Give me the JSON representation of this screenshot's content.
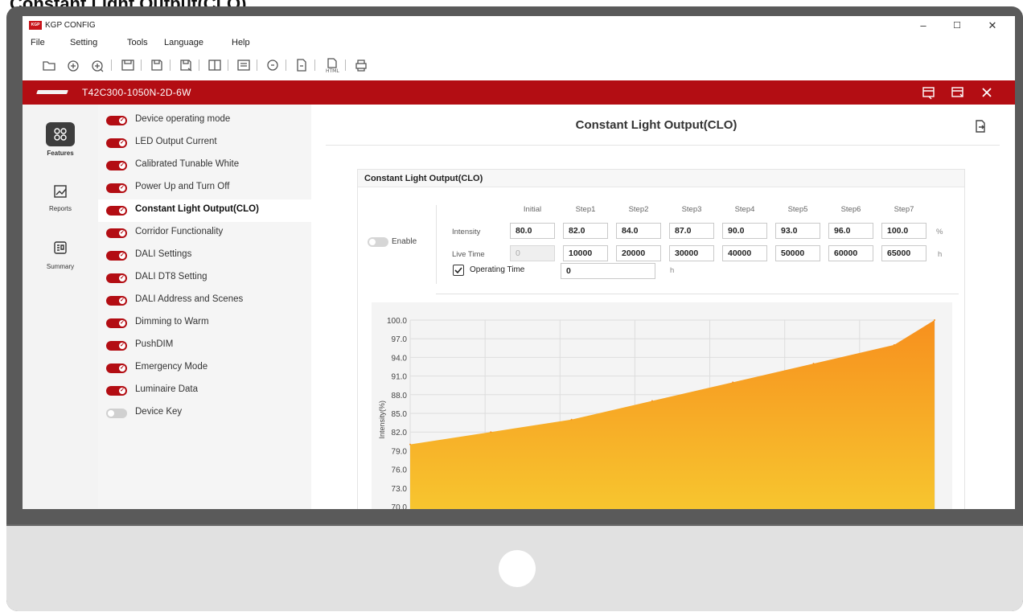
{
  "heading": "Constant Light Output(CLO)",
  "app": {
    "logo_text": "KGP",
    "title": "KGP CONFIG"
  },
  "window_controls": {
    "minimize": "–",
    "maximize": "☐",
    "close": "✕"
  },
  "menu": [
    "File",
    "Setting",
    "Tools",
    "Language",
    "Help"
  ],
  "device": {
    "name": "T42C300-1050N-2D-6W"
  },
  "nav": [
    {
      "label": "Features",
      "icon": "features-icon",
      "active": true
    },
    {
      "label": "Reports",
      "icon": "reports-icon",
      "active": false
    },
    {
      "label": "Summary",
      "icon": "summary-icon",
      "active": false
    }
  ],
  "features": [
    {
      "label": "Device operating mode",
      "enabled": true
    },
    {
      "label": "LED Output Current",
      "enabled": true
    },
    {
      "label": "Calibrated Tunable White",
      "enabled": true
    },
    {
      "label": "Power Up and Turn Off",
      "enabled": true
    },
    {
      "label": "Constant Light Output(CLO)",
      "enabled": true
    },
    {
      "label": "Corridor Functionality",
      "enabled": true
    },
    {
      "label": "DALI Settings",
      "enabled": true
    },
    {
      "label": "DALI DT8 Setting",
      "enabled": true
    },
    {
      "label": "DALI Address and Scenes",
      "enabled": true
    },
    {
      "label": "Dimming to Warm",
      "enabled": true
    },
    {
      "label": "PushDIM",
      "enabled": true
    },
    {
      "label": "Emergency Mode",
      "enabled": true
    },
    {
      "label": "Luminaire Data",
      "enabled": true
    },
    {
      "label": "Device Key",
      "enabled": false
    }
  ],
  "main": {
    "title": "Constant Light Output(CLO)",
    "panel_title": "Constant Light Output(CLO)",
    "enable_label": "Enable",
    "columns": [
      "Initial",
      "Step1",
      "Step2",
      "Step3",
      "Step4",
      "Step5",
      "Step6",
      "Step7"
    ],
    "intensity_label": "Intensity",
    "intensity_unit": "%",
    "intensity": [
      "80.0",
      "82.0",
      "84.0",
      "87.0",
      "90.0",
      "93.0",
      "96.0",
      "100.0"
    ],
    "livetime_label": "Live Time",
    "livetime_unit": "h",
    "livetime": [
      "0",
      "10000",
      "20000",
      "30000",
      "40000",
      "50000",
      "60000",
      "65000"
    ],
    "operating_time_label": "Operating Time",
    "operating_time_value": "0",
    "operating_time_unit": "h",
    "operating_time_checked": true
  },
  "chart_data": {
    "type": "area",
    "ylabel": "Intensity(%)",
    "yticks": [
      "100.0",
      "97.0",
      "94.0",
      "91.0",
      "88.0",
      "85.0",
      "82.0",
      "79.0",
      "76.0",
      "73.0",
      "70.0"
    ],
    "ylim": [
      70,
      100
    ],
    "x": [
      0,
      10000,
      20000,
      30000,
      40000,
      50000,
      60000,
      65000
    ],
    "y": [
      80,
      82,
      84,
      87,
      90,
      93,
      96,
      100
    ],
    "grid": true,
    "colors": {
      "top": "#f7901e",
      "bottom": "#f7c62f",
      "background": "#f4f4f4",
      "grid": "#dddddd"
    }
  }
}
